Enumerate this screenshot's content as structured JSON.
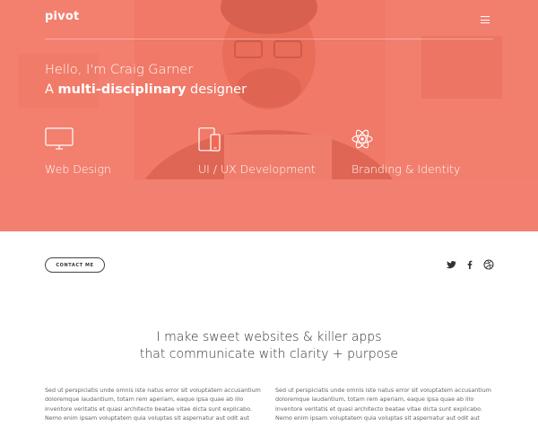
{
  "brand": {
    "logo": "pivot"
  },
  "hero": {
    "greeting": "Hello, I'm Craig Garner",
    "tagline_prefix": "A ",
    "tagline_bold": "multi-disciplinary",
    "tagline_suffix": " designer",
    "overlay_color": "#f26452"
  },
  "services": [
    {
      "label": "Web Design",
      "icon": "monitor-icon"
    },
    {
      "label": "UI / UX Development",
      "icon": "devices-icon"
    },
    {
      "label": "Branding & Identity",
      "icon": "atom-icon"
    }
  ],
  "contact": {
    "button_label": "CONTACT ME"
  },
  "social": [
    {
      "name": "twitter-icon"
    },
    {
      "name": "facebook-icon"
    },
    {
      "name": "dribbble-icon"
    }
  ],
  "statement": {
    "line1": "I make sweet websites & killer apps",
    "line2": "that communicate with clarity + purpose"
  },
  "columns": [
    {
      "lines": [
        "Sed ut perspiciatis unde omnis iste natus error sit voluptatem accusantium",
        "doloremque laudantium, totam rem aperiam, eaque ipsa quae ab illo",
        "inventore veritatis et quasi architecto beatae vitae dicta sunt explicabo.",
        "Nemo enim ipsam voluptatem quia voluptas sit aspernatur aut odit aut"
      ]
    },
    {
      "lines": [
        "Sed ut perspiciatis unde omnis iste natus error sit voluptatem accusantium",
        "doloremque laudantium, totam rem aperiam, eaque ipsa quae ab illo",
        "inventore veritatis et quasi architecto beatae vitae dicta sunt explicabo.",
        "Nemo enim ipsam voluptatem quia voluptas sit aspernatur aut odit aut"
      ]
    }
  ]
}
